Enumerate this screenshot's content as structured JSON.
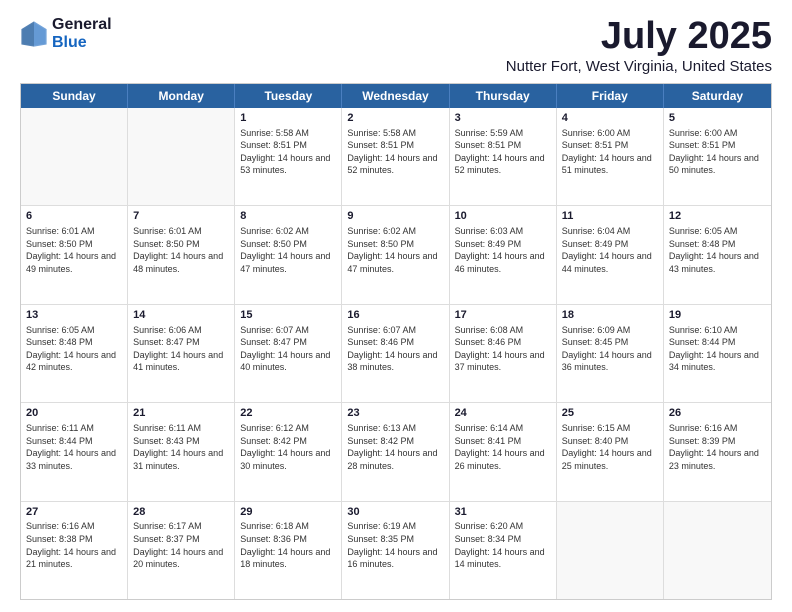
{
  "logo": {
    "general": "General",
    "blue": "Blue"
  },
  "title": "July 2025",
  "subtitle": "Nutter Fort, West Virginia, United States",
  "days": [
    "Sunday",
    "Monday",
    "Tuesday",
    "Wednesday",
    "Thursday",
    "Friday",
    "Saturday"
  ],
  "weeks": [
    [
      {
        "day": "",
        "sunrise": "",
        "sunset": "",
        "daylight": ""
      },
      {
        "day": "",
        "sunrise": "",
        "sunset": "",
        "daylight": ""
      },
      {
        "day": "1",
        "sunrise": "Sunrise: 5:58 AM",
        "sunset": "Sunset: 8:51 PM",
        "daylight": "Daylight: 14 hours and 53 minutes."
      },
      {
        "day": "2",
        "sunrise": "Sunrise: 5:58 AM",
        "sunset": "Sunset: 8:51 PM",
        "daylight": "Daylight: 14 hours and 52 minutes."
      },
      {
        "day": "3",
        "sunrise": "Sunrise: 5:59 AM",
        "sunset": "Sunset: 8:51 PM",
        "daylight": "Daylight: 14 hours and 52 minutes."
      },
      {
        "day": "4",
        "sunrise": "Sunrise: 6:00 AM",
        "sunset": "Sunset: 8:51 PM",
        "daylight": "Daylight: 14 hours and 51 minutes."
      },
      {
        "day": "5",
        "sunrise": "Sunrise: 6:00 AM",
        "sunset": "Sunset: 8:51 PM",
        "daylight": "Daylight: 14 hours and 50 minutes."
      }
    ],
    [
      {
        "day": "6",
        "sunrise": "Sunrise: 6:01 AM",
        "sunset": "Sunset: 8:50 PM",
        "daylight": "Daylight: 14 hours and 49 minutes."
      },
      {
        "day": "7",
        "sunrise": "Sunrise: 6:01 AM",
        "sunset": "Sunset: 8:50 PM",
        "daylight": "Daylight: 14 hours and 48 minutes."
      },
      {
        "day": "8",
        "sunrise": "Sunrise: 6:02 AM",
        "sunset": "Sunset: 8:50 PM",
        "daylight": "Daylight: 14 hours and 47 minutes."
      },
      {
        "day": "9",
        "sunrise": "Sunrise: 6:02 AM",
        "sunset": "Sunset: 8:50 PM",
        "daylight": "Daylight: 14 hours and 47 minutes."
      },
      {
        "day": "10",
        "sunrise": "Sunrise: 6:03 AM",
        "sunset": "Sunset: 8:49 PM",
        "daylight": "Daylight: 14 hours and 46 minutes."
      },
      {
        "day": "11",
        "sunrise": "Sunrise: 6:04 AM",
        "sunset": "Sunset: 8:49 PM",
        "daylight": "Daylight: 14 hours and 44 minutes."
      },
      {
        "day": "12",
        "sunrise": "Sunrise: 6:05 AM",
        "sunset": "Sunset: 8:48 PM",
        "daylight": "Daylight: 14 hours and 43 minutes."
      }
    ],
    [
      {
        "day": "13",
        "sunrise": "Sunrise: 6:05 AM",
        "sunset": "Sunset: 8:48 PM",
        "daylight": "Daylight: 14 hours and 42 minutes."
      },
      {
        "day": "14",
        "sunrise": "Sunrise: 6:06 AM",
        "sunset": "Sunset: 8:47 PM",
        "daylight": "Daylight: 14 hours and 41 minutes."
      },
      {
        "day": "15",
        "sunrise": "Sunrise: 6:07 AM",
        "sunset": "Sunset: 8:47 PM",
        "daylight": "Daylight: 14 hours and 40 minutes."
      },
      {
        "day": "16",
        "sunrise": "Sunrise: 6:07 AM",
        "sunset": "Sunset: 8:46 PM",
        "daylight": "Daylight: 14 hours and 38 minutes."
      },
      {
        "day": "17",
        "sunrise": "Sunrise: 6:08 AM",
        "sunset": "Sunset: 8:46 PM",
        "daylight": "Daylight: 14 hours and 37 minutes."
      },
      {
        "day": "18",
        "sunrise": "Sunrise: 6:09 AM",
        "sunset": "Sunset: 8:45 PM",
        "daylight": "Daylight: 14 hours and 36 minutes."
      },
      {
        "day": "19",
        "sunrise": "Sunrise: 6:10 AM",
        "sunset": "Sunset: 8:44 PM",
        "daylight": "Daylight: 14 hours and 34 minutes."
      }
    ],
    [
      {
        "day": "20",
        "sunrise": "Sunrise: 6:11 AM",
        "sunset": "Sunset: 8:44 PM",
        "daylight": "Daylight: 14 hours and 33 minutes."
      },
      {
        "day": "21",
        "sunrise": "Sunrise: 6:11 AM",
        "sunset": "Sunset: 8:43 PM",
        "daylight": "Daylight: 14 hours and 31 minutes."
      },
      {
        "day": "22",
        "sunrise": "Sunrise: 6:12 AM",
        "sunset": "Sunset: 8:42 PM",
        "daylight": "Daylight: 14 hours and 30 minutes."
      },
      {
        "day": "23",
        "sunrise": "Sunrise: 6:13 AM",
        "sunset": "Sunset: 8:42 PM",
        "daylight": "Daylight: 14 hours and 28 minutes."
      },
      {
        "day": "24",
        "sunrise": "Sunrise: 6:14 AM",
        "sunset": "Sunset: 8:41 PM",
        "daylight": "Daylight: 14 hours and 26 minutes."
      },
      {
        "day": "25",
        "sunrise": "Sunrise: 6:15 AM",
        "sunset": "Sunset: 8:40 PM",
        "daylight": "Daylight: 14 hours and 25 minutes."
      },
      {
        "day": "26",
        "sunrise": "Sunrise: 6:16 AM",
        "sunset": "Sunset: 8:39 PM",
        "daylight": "Daylight: 14 hours and 23 minutes."
      }
    ],
    [
      {
        "day": "27",
        "sunrise": "Sunrise: 6:16 AM",
        "sunset": "Sunset: 8:38 PM",
        "daylight": "Daylight: 14 hours and 21 minutes."
      },
      {
        "day": "28",
        "sunrise": "Sunrise: 6:17 AM",
        "sunset": "Sunset: 8:37 PM",
        "daylight": "Daylight: 14 hours and 20 minutes."
      },
      {
        "day": "29",
        "sunrise": "Sunrise: 6:18 AM",
        "sunset": "Sunset: 8:36 PM",
        "daylight": "Daylight: 14 hours and 18 minutes."
      },
      {
        "day": "30",
        "sunrise": "Sunrise: 6:19 AM",
        "sunset": "Sunset: 8:35 PM",
        "daylight": "Daylight: 14 hours and 16 minutes."
      },
      {
        "day": "31",
        "sunrise": "Sunrise: 6:20 AM",
        "sunset": "Sunset: 8:34 PM",
        "daylight": "Daylight: 14 hours and 14 minutes."
      },
      {
        "day": "",
        "sunrise": "",
        "sunset": "",
        "daylight": ""
      },
      {
        "day": "",
        "sunrise": "",
        "sunset": "",
        "daylight": ""
      }
    ]
  ]
}
